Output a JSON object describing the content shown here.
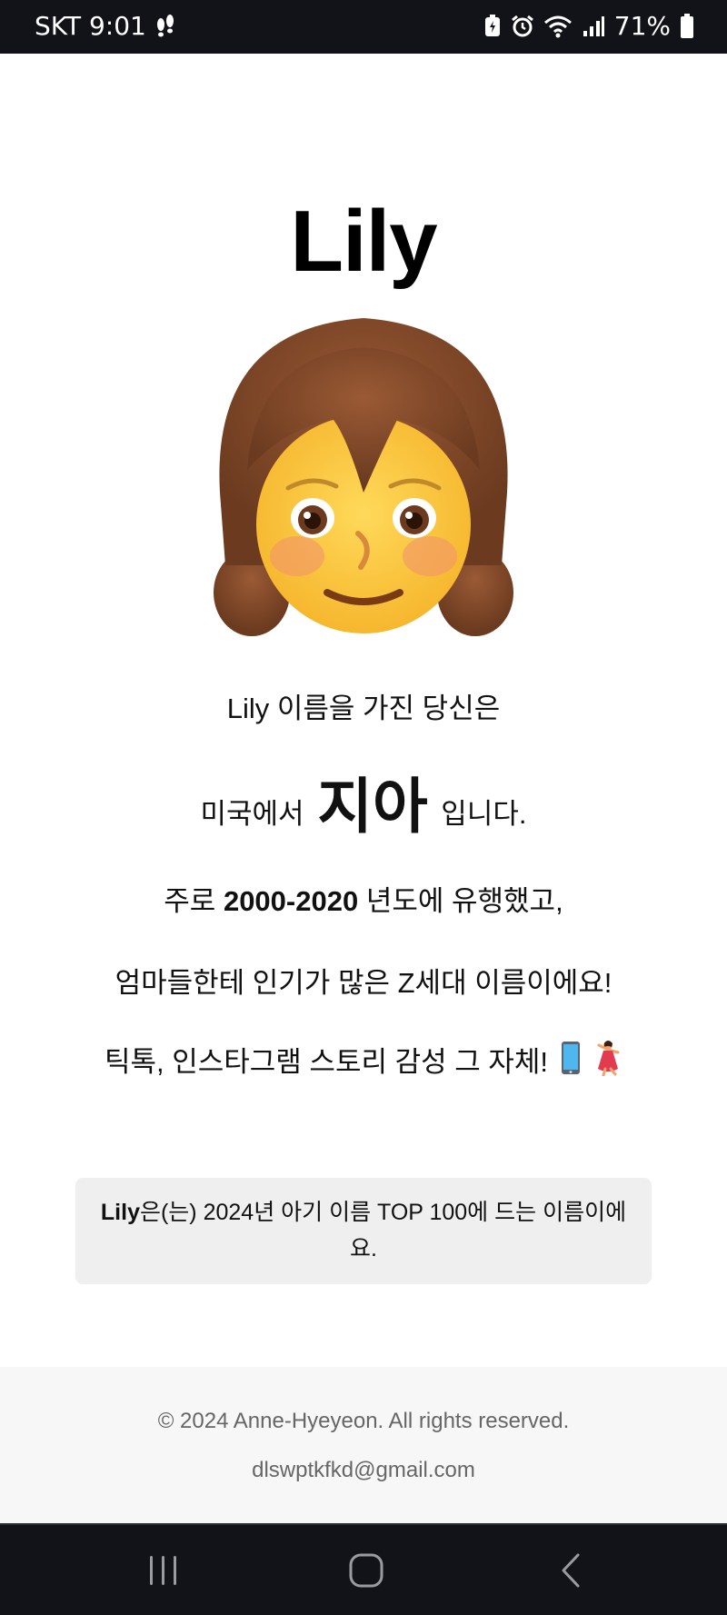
{
  "status_bar": {
    "carrier_time": "SKT 9:01",
    "battery": "71%",
    "icons": [
      "footsteps-icon",
      "battery-saver-icon",
      "alarm-icon",
      "wifi-icon",
      "signal-icon",
      "battery-icon"
    ]
  },
  "name": "Lily",
  "avatar_icon": "girl-emoji",
  "lines": {
    "line1": "Lily 이름을 가진 당신은",
    "line2_prefix": "미국에서",
    "line2_highlight": "지아",
    "line2_suffix": "입니다.",
    "line3_prefix": "주로",
    "line3_years": "2000-2020",
    "line3_suffix": "년도에 유행했고,",
    "line4": "엄마들한테 인기가 많은 Z세대 이름이에요!",
    "line5": "틱톡, 인스타그램 스토리 감성 그 자체!",
    "line5_icons": [
      "mobile-phone-emoji",
      "dancer-emoji"
    ]
  },
  "notice": {
    "name": "Lily",
    "text": "은(는) 2024년 아기 이름 TOP 100에 드는 이름이에요."
  },
  "footer": {
    "copyright": "© 2024 Anne-Hyeyeon. All rights reserved.",
    "email": "dlswptkfkd@gmail.com"
  },
  "nav_bar": {
    "icons": [
      "recent-apps-icon",
      "home-icon",
      "back-icon"
    ]
  },
  "colors": {
    "status_bar_bg": "#121318",
    "notice_bg": "#efefef",
    "footer_bg": "#f7f7f7",
    "footer_text": "#666666"
  }
}
